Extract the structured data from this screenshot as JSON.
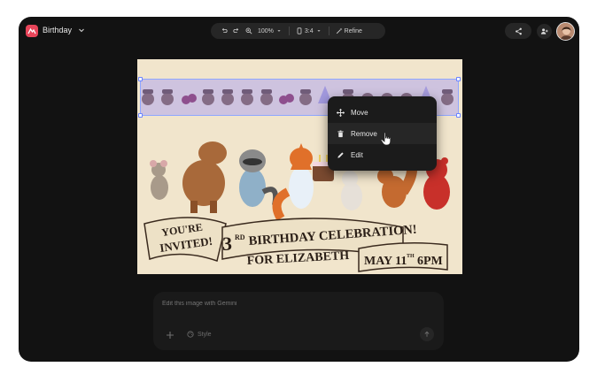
{
  "header": {
    "title": "Birthday"
  },
  "toolbar": {
    "zoom": "100%",
    "aspect_ratio": "3:4",
    "refine_label": "Refine"
  },
  "artboard": {
    "banner": {
      "line1a": "YOU'RE",
      "line1b": "INVITED!",
      "ordinal": "3",
      "ordinal_suffix": "RD",
      "headline": "BIRTHDAY CELEBRATION!",
      "for_line": "FOR ELIZABETH",
      "date_line": "MAY 11",
      "date_suffix": "TH",
      "time": "6PM"
    }
  },
  "context_menu": {
    "items": [
      {
        "label": "Move",
        "icon": "move-icon"
      },
      {
        "label": "Remove",
        "icon": "trash-icon"
      },
      {
        "label": "Edit",
        "icon": "pencil-icon"
      }
    ]
  },
  "prompt": {
    "placeholder": "Edit this image with Gemini",
    "style_label": "Style"
  },
  "colors": {
    "window_bg": "#121212",
    "logo": "#e8455a",
    "selection": "#8fa6ff",
    "paper": "#f1e5cc"
  }
}
